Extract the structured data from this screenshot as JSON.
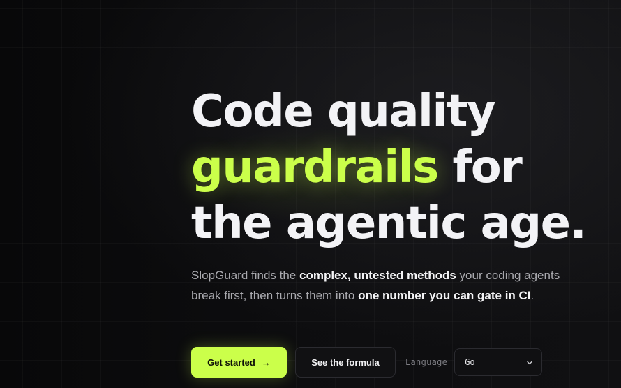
{
  "hero": {
    "headline": {
      "line1": "Code quality",
      "accent": "guardrails",
      "line2_rest": " for",
      "line3": "the agentic age."
    },
    "lede": {
      "part1": "SlopGuard finds the ",
      "bold1": "complex, untested methods",
      "part2": " your coding agents break first, then turns them into ",
      "bold2": "one number you can gate in CI",
      "part3": "."
    }
  },
  "actions": {
    "primary_label": "Get started",
    "primary_icon": "arrow-right-icon",
    "secondary_label": "See the formula",
    "language_label": "Language",
    "language_selected": "Go",
    "select_icon": "chevron-down-icon"
  },
  "colors": {
    "accent": "#cbff4a",
    "background": "#0b0b0c",
    "text": "#f3f3f6",
    "muted": "#a9a9ae"
  }
}
